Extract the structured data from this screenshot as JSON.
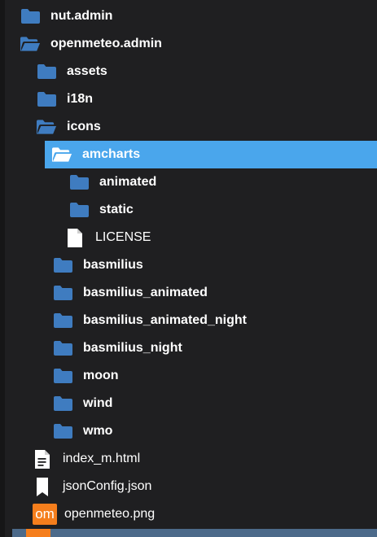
{
  "tree": {
    "items": [
      {
        "label": "nut.admin",
        "icon": "folder-closed-icon",
        "indent": 0,
        "bold": true
      },
      {
        "label": "openmeteo.admin",
        "icon": "folder-open-icon",
        "indent": 0,
        "bold": true
      },
      {
        "label": "assets",
        "icon": "folder-closed-icon",
        "indent": 1,
        "bold": true
      },
      {
        "label": "i18n",
        "icon": "folder-closed-icon",
        "indent": 1,
        "bold": true
      },
      {
        "label": "icons",
        "icon": "folder-open-icon",
        "indent": 1,
        "bold": true
      },
      {
        "label": "amcharts",
        "icon": "folder-open-icon",
        "indent": 2,
        "bold": true,
        "selected": true
      },
      {
        "label": "animated",
        "icon": "folder-closed-icon",
        "indent": 3,
        "bold": true
      },
      {
        "label": "static",
        "icon": "folder-closed-icon",
        "indent": 3,
        "bold": true
      },
      {
        "label": "LICENSE",
        "icon": "file-icon",
        "indent": 2.75,
        "bold": false
      },
      {
        "label": "basmilius",
        "icon": "folder-closed-icon",
        "indent": 2,
        "bold": true
      },
      {
        "label": "basmilius_animated",
        "icon": "folder-closed-icon",
        "indent": 2,
        "bold": true
      },
      {
        "label": "basmilius_animated_night",
        "icon": "folder-closed-icon",
        "indent": 2,
        "bold": true
      },
      {
        "label": "basmilius_night",
        "icon": "folder-closed-icon",
        "indent": 2,
        "bold": true
      },
      {
        "label": "moon",
        "icon": "folder-closed-icon",
        "indent": 2,
        "bold": true
      },
      {
        "label": "wind",
        "icon": "folder-closed-icon",
        "indent": 2,
        "bold": true
      },
      {
        "label": "wmo",
        "icon": "folder-closed-icon",
        "indent": 2,
        "bold": true
      },
      {
        "label": "index_m.html",
        "icon": "html-file-icon",
        "indent": 0.75,
        "bold": false
      },
      {
        "label": "jsonConfig.json",
        "icon": "bookmark-file-icon",
        "indent": 0.75,
        "bold": false
      },
      {
        "label": "openmeteo.png",
        "icon": "png-file-icon",
        "icon_text": "om",
        "indent": 0.75,
        "bold": false
      }
    ]
  },
  "colors": {
    "background": "#1f1f21",
    "selected": "#4aa6ec",
    "folder": "#3f7cc0",
    "folder_selected": "#ffffff",
    "text": "#ffffff",
    "png_badge": "#f57e1c",
    "bottom_bar": "#4c6a8a"
  }
}
